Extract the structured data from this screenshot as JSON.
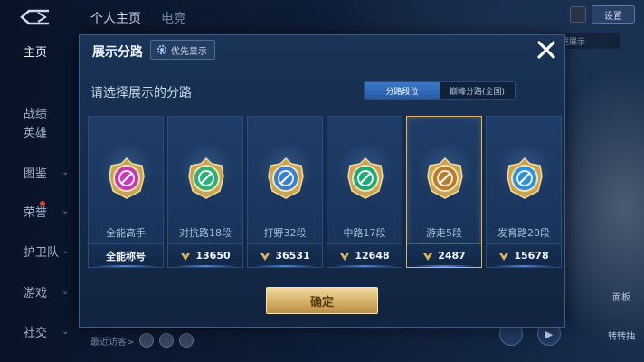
{
  "sidebar": {
    "items": [
      {
        "label": "主页",
        "active": true,
        "chevron": false,
        "dot": false
      },
      {
        "label": "战绩",
        "active": false,
        "chevron": false,
        "dot": false
      },
      {
        "label": "英雄",
        "active": false,
        "chevron": false,
        "dot": false
      },
      {
        "label": "图鉴",
        "active": false,
        "chevron": true,
        "dot": false
      },
      {
        "label": "荣誉",
        "active": false,
        "chevron": true,
        "dot": true
      },
      {
        "label": "护卫队",
        "active": false,
        "chevron": true,
        "dot": false
      },
      {
        "label": "游戏",
        "active": false,
        "chevron": true,
        "dot": false
      },
      {
        "label": "社交",
        "active": false,
        "chevron": true,
        "dot": false
      }
    ]
  },
  "top": {
    "tab_profile": "个人主页",
    "tab_second": "电竞",
    "right_button": "设置",
    "hint": "和数据展示"
  },
  "bottom": {
    "visitors_label": "最近访客>",
    "right_label_1": "面板",
    "right_label_2": "转转抽"
  },
  "modal": {
    "title": "展示分路",
    "priority_label": "优先显示",
    "subtitle": "请选择展示的分路",
    "seg_left": "分路段位",
    "seg_right": "巅峰分路(全国)",
    "confirm_label": "确定",
    "cards": [
      {
        "name": "全能高手",
        "value": "全能称号",
        "has_icon": false,
        "emblem_color": "#c23bb5",
        "selected": false
      },
      {
        "name": "对抗路18段",
        "value": "13650",
        "has_icon": true,
        "emblem_color": "#2fae7a",
        "selected": false
      },
      {
        "name": "打野32段",
        "value": "36531",
        "has_icon": true,
        "emblem_color": "#3a7fcf",
        "selected": false
      },
      {
        "name": "中路17段",
        "value": "12648",
        "has_icon": true,
        "emblem_color": "#23a57a",
        "selected": false
      },
      {
        "name": "游走5段",
        "value": "2487",
        "has_icon": true,
        "emblem_color": "#b77b2a",
        "selected": true
      },
      {
        "name": "发育路20段",
        "value": "15678",
        "has_icon": true,
        "emblem_color": "#2f8fd8",
        "selected": false
      }
    ]
  }
}
